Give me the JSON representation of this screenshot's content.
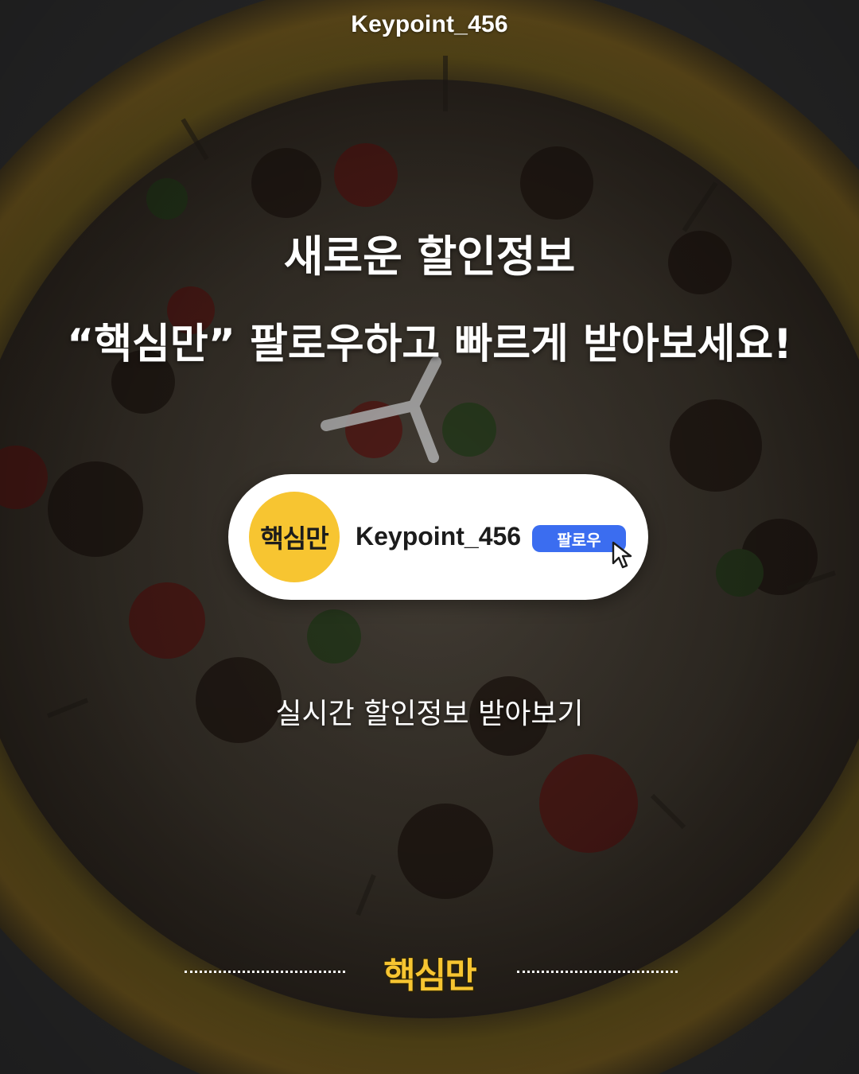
{
  "header": {
    "handle": "Keypoint_456"
  },
  "headline": {
    "line1": "새로운 할인정보",
    "line2": "“핵심만” 팔로우하고 빠르게 받아보세요!"
  },
  "profile_card": {
    "avatar_text": "핵심만",
    "username": "Keypoint_456",
    "follow_label": "팔로우"
  },
  "subtext": "실시간 할인정보 받아보기",
  "footer": {
    "logo_text": "핵심만"
  },
  "colors": {
    "brand_yellow": "#f7c531",
    "follow_blue": "#3b6df0",
    "card_white": "#ffffff"
  }
}
